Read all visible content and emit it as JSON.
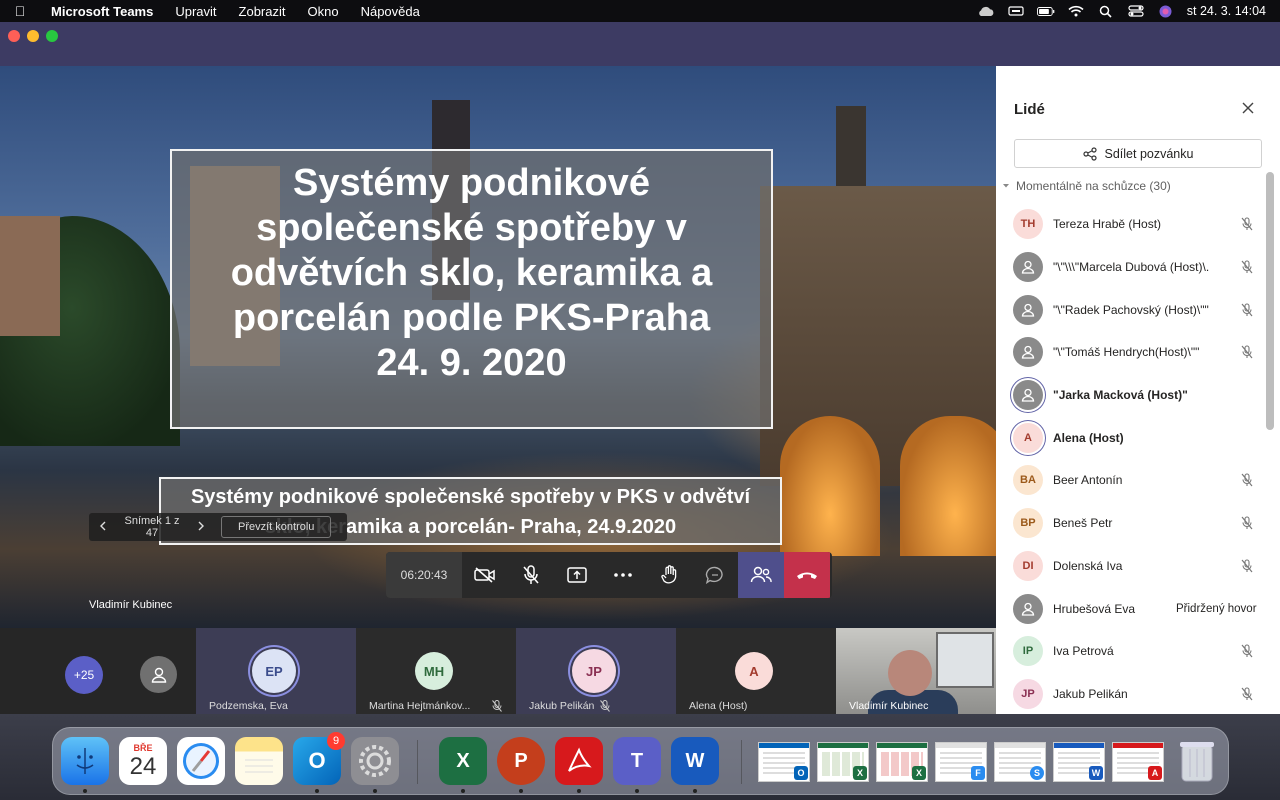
{
  "menubar": {
    "app_name": "Microsoft Teams",
    "items": [
      "Upravit",
      "Zobrazit",
      "Okno",
      "Nápověda"
    ],
    "datetime": "st 24. 3.  14:04"
  },
  "slide": {
    "title_lines": [
      "Systémy podnikové",
      "společenské spotřeby v",
      "odvětvích sklo, keramika a",
      "porcelán podle PKS-Praha",
      "24. 9. 2020"
    ],
    "subtitle_lines": [
      "Systémy podnikové společenské spotřeby v PKS v odvětví",
      "sklo, keramika  a porcelán- Praha, 24.9.2020"
    ],
    "nav_counter": "Snímek 1 z 47",
    "take_control": "Převzít kontrolu",
    "presenter_name": "Vladimír Kubinec"
  },
  "controls": {
    "timer": "06:20:43"
  },
  "strip": {
    "overflow_count": "+25",
    "tiles": [
      {
        "initials": "EP",
        "label": "Podzemska, Eva",
        "bg": "#dce3f5",
        "fg": "#3b4c8c"
      },
      {
        "initials": "MH",
        "label": "Martina Hejtmánkov...",
        "bg": "#d7eedd",
        "fg": "#2f6b3d"
      },
      {
        "initials": "JP",
        "label": "Jakub Pelikán",
        "bg": "#f6d9e3",
        "fg": "#8a2f52"
      },
      {
        "initials": "A",
        "label": "Alena (Host)",
        "bg": "#fadcd9",
        "fg": "#a33b2e"
      }
    ],
    "video_label": "Vladimír Kubinec"
  },
  "panel": {
    "title": "Lidé",
    "share_label": "Sdílet pozvánku",
    "section_label": "Momentálně na schůzce (30)",
    "people": [
      {
        "initials": "TH",
        "name": "Tereza Hrabě (Host)",
        "bg": "#fadcd9",
        "fg": "#a33b2e",
        "bold": false,
        "muted": true,
        "generic": false,
        "ring": false,
        "status": ""
      },
      {
        "initials": "",
        "name": "\"\\\"\\\\\\\"Marcela Dubová (Host)\\.",
        "bg": "#8a8a8a",
        "fg": "#fff",
        "bold": false,
        "muted": true,
        "generic": true,
        "ring": false,
        "status": ""
      },
      {
        "initials": "",
        "name": "\"\\\"Radek Pachovský (Host)\\\"\"",
        "bg": "#8a8a8a",
        "fg": "#fff",
        "bold": false,
        "muted": true,
        "generic": true,
        "ring": false,
        "status": ""
      },
      {
        "initials": "",
        "name": "\"\\\"Tomáš Hendrych(Host)\\\"\"",
        "bg": "#8a8a8a",
        "fg": "#fff",
        "bold": false,
        "muted": true,
        "generic": true,
        "ring": false,
        "status": ""
      },
      {
        "initials": "",
        "name": "\"Jarka Macková (Host)\"",
        "bg": "#8a8a8a",
        "fg": "#fff",
        "bold": true,
        "muted": false,
        "generic": true,
        "ring": true,
        "status": ""
      },
      {
        "initials": "A",
        "name": "Alena (Host)",
        "bg": "#fadcd9",
        "fg": "#a33b2e",
        "bold": true,
        "muted": false,
        "generic": false,
        "ring": true,
        "status": ""
      },
      {
        "initials": "BA",
        "name": "Beer Antonín",
        "bg": "#fbe6d0",
        "fg": "#9c5a1b",
        "bold": false,
        "muted": true,
        "generic": false,
        "ring": false,
        "status": ""
      },
      {
        "initials": "BP",
        "name": "Beneš Petr",
        "bg": "#fbe6d0",
        "fg": "#9c5a1b",
        "bold": false,
        "muted": true,
        "generic": false,
        "ring": false,
        "status": ""
      },
      {
        "initials": "DI",
        "name": "Dolenská Iva",
        "bg": "#fadcd9",
        "fg": "#a33b2e",
        "bold": false,
        "muted": true,
        "generic": false,
        "ring": false,
        "status": ""
      },
      {
        "initials": "",
        "name": "Hrubešová Eva",
        "bg": "#8a8a8a",
        "fg": "#fff",
        "bold": false,
        "muted": false,
        "generic": true,
        "ring": false,
        "status": "Přidržený hovor"
      },
      {
        "initials": "IP",
        "name": "Iva Petrová",
        "bg": "#d7eedd",
        "fg": "#2f6b3d",
        "bold": false,
        "muted": true,
        "generic": false,
        "ring": false,
        "status": ""
      },
      {
        "initials": "JP",
        "name": "Jakub Pelikán",
        "bg": "#f6d9e3",
        "fg": "#8a2f52",
        "bold": false,
        "muted": true,
        "generic": false,
        "ring": false,
        "status": ""
      }
    ]
  },
  "dock": {
    "calendar_month": "BŘE",
    "calendar_day": "24",
    "outlook_badge": "9"
  }
}
